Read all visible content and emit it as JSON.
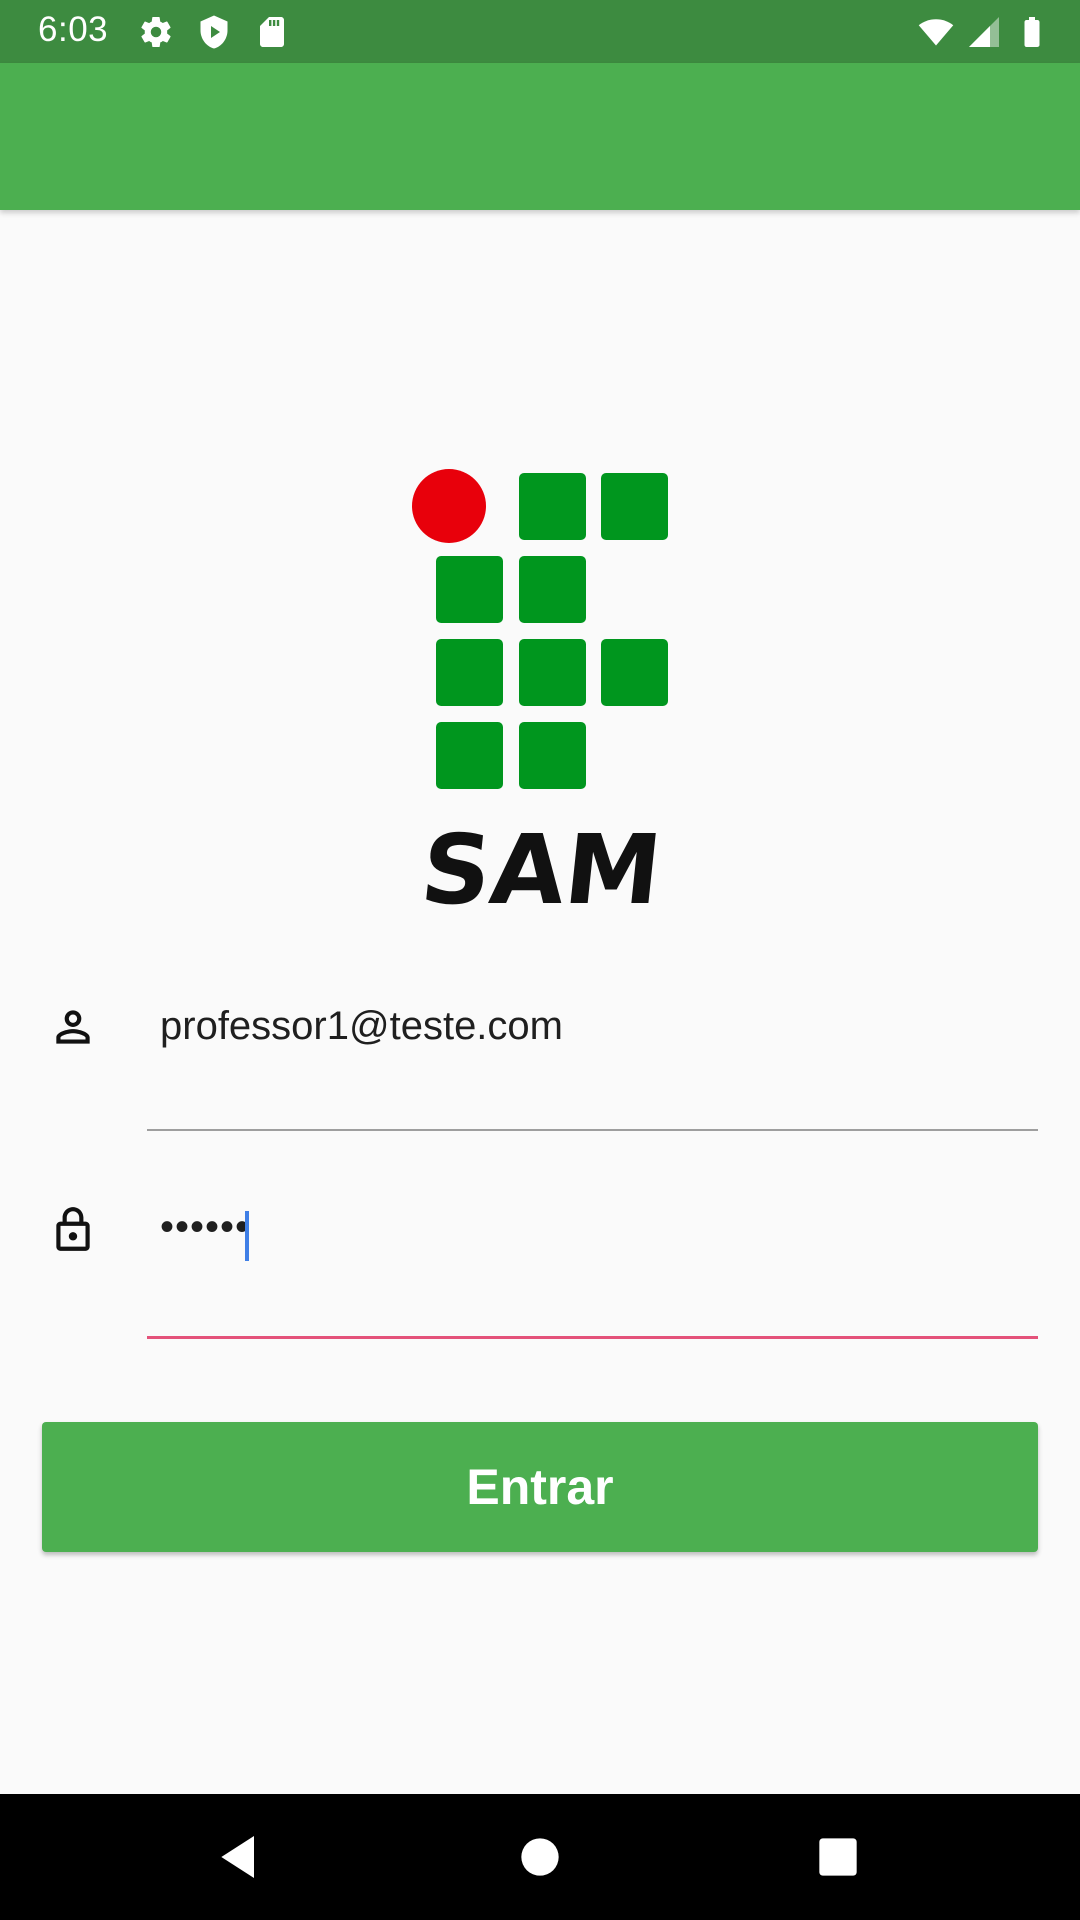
{
  "status_bar": {
    "time": "6:03",
    "left_icons": [
      "settings-icon",
      "play-protect-icon",
      "sd-card-icon"
    ],
    "right_icons": [
      "wifi-icon",
      "cell-signal-icon",
      "battery-icon"
    ],
    "color": "#3d8b40"
  },
  "app_bar": {
    "color": "#4caf50"
  },
  "logo": {
    "wordmark": "SAM",
    "grid_color": "#00961e",
    "dot_color": "#e8000b"
  },
  "form": {
    "email": {
      "value": "professor1@teste.com",
      "icon": "person-icon"
    },
    "password": {
      "value": "••••••",
      "icon": "lock-icon",
      "underline_color": "#e4527a"
    }
  },
  "login_button": {
    "label": "Entrar",
    "color": "#4caf50"
  },
  "nav_bar": {
    "buttons": [
      "back-icon",
      "home-icon",
      "recents-icon"
    ]
  }
}
